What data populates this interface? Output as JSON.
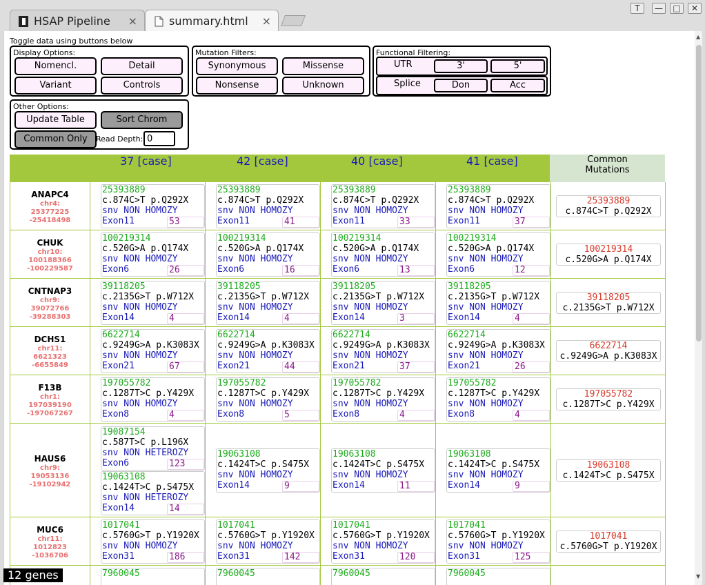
{
  "browser": {
    "tabs": [
      {
        "label": "HSAP Pipeline",
        "close": "×"
      },
      {
        "label": "summary.html",
        "close": "×"
      }
    ],
    "window_buttons": [
      "T",
      "—",
      "□",
      "✕"
    ]
  },
  "toggle_text": "Toggle data using buttons below",
  "display": {
    "title": "Display Options:",
    "nomencl": "Nomencl.",
    "detail": "Detail",
    "variant": "Variant",
    "controls": "Controls"
  },
  "mutation": {
    "title": "Mutation Filters:",
    "synonymous": "Synonymous",
    "missense": "Missense",
    "nonsense": "Nonsense",
    "unknown": "Unknown"
  },
  "functional": {
    "title": "Functional Filtering:",
    "utr": "UTR",
    "utr3": "3'",
    "utr5": "5'",
    "splice": "Splice",
    "don": "Don",
    "acc": "Acc"
  },
  "other": {
    "title": "Other Options:",
    "update": "Update Table",
    "sort": "Sort Chrom",
    "common_only": "Common Only",
    "read_depth_label": "Read Depth:",
    "read_depth_value": "0"
  },
  "header": {
    "cases": [
      "37 [case]",
      "42 [case]",
      "40 [case]",
      "41 [case]"
    ],
    "common": "Common Mutations"
  },
  "genes": [
    {
      "name": "ANAPC4",
      "chr": "chr4:",
      "start": "25377225",
      "end": "-25418498",
      "cards": [
        [
          {
            "pos": "25393889",
            "change": "c.874C>T p.Q292X",
            "type": "snv NON HOMOZY",
            "exon": "Exon11",
            "depth": "53"
          }
        ],
        [
          {
            "pos": "25393889",
            "change": "c.874C>T p.Q292X",
            "type": "snv NON HOMOZY",
            "exon": "Exon11",
            "depth": "41"
          }
        ],
        [
          {
            "pos": "25393889",
            "change": "c.874C>T p.Q292X",
            "type": "snv NON HOMOZY",
            "exon": "Exon11",
            "depth": "33"
          }
        ],
        [
          {
            "pos": "25393889",
            "change": "c.874C>T p.Q292X",
            "type": "snv NON HOMOZY",
            "exon": "Exon11",
            "depth": "37"
          }
        ]
      ],
      "common": {
        "pos": "25393889",
        "change": "c.874C>T p.Q292X"
      }
    },
    {
      "name": "CHUK",
      "chr": "chr10:",
      "start": "100188366",
      "end": "-100229587",
      "cards": [
        [
          {
            "pos": "100219314",
            "change": "c.520G>A p.Q174X",
            "type": "snv NON HOMOZY",
            "exon": "Exon6",
            "depth": "26"
          }
        ],
        [
          {
            "pos": "100219314",
            "change": "c.520G>A p.Q174X",
            "type": "snv NON HOMOZY",
            "exon": "Exon6",
            "depth": "16"
          }
        ],
        [
          {
            "pos": "100219314",
            "change": "c.520G>A p.Q174X",
            "type": "snv NON HOMOZY",
            "exon": "Exon6",
            "depth": "13"
          }
        ],
        [
          {
            "pos": "100219314",
            "change": "c.520G>A p.Q174X",
            "type": "snv NON HOMOZY",
            "exon": "Exon6",
            "depth": "12"
          }
        ]
      ],
      "common": {
        "pos": "100219314",
        "change": "c.520G>A p.Q174X"
      }
    },
    {
      "name": "CNTNAP3",
      "chr": "chr9:",
      "start": "39072766",
      "end": "-39288303",
      "cards": [
        [
          {
            "pos": "39118205",
            "change": "c.2135G>T p.W712X",
            "type": "snv NON HOMOZY",
            "exon": "Exon14",
            "depth": "4"
          }
        ],
        [
          {
            "pos": "39118205",
            "change": "c.2135G>T p.W712X",
            "type": "snv NON HOMOZY",
            "exon": "Exon14",
            "depth": "4"
          }
        ],
        [
          {
            "pos": "39118205",
            "change": "c.2135G>T p.W712X",
            "type": "snv NON HOMOZY",
            "exon": "Exon14",
            "depth": "3"
          }
        ],
        [
          {
            "pos": "39118205",
            "change": "c.2135G>T p.W712X",
            "type": "snv NON HOMOZY",
            "exon": "Exon14",
            "depth": "4"
          }
        ]
      ],
      "common": {
        "pos": "39118205",
        "change": "c.2135G>T p.W712X"
      }
    },
    {
      "name": "DCHS1",
      "chr": "chr11:",
      "start": "6621323",
      "end": "-6655849",
      "cards": [
        [
          {
            "pos": "6622714",
            "change": "c.9249G>A p.K3083X",
            "type": "snv NON HOMOZY",
            "exon": "Exon21",
            "depth": "67"
          }
        ],
        [
          {
            "pos": "6622714",
            "change": "c.9249G>A p.K3083X",
            "type": "snv NON HOMOZY",
            "exon": "Exon21",
            "depth": "44"
          }
        ],
        [
          {
            "pos": "6622714",
            "change": "c.9249G>A p.K3083X",
            "type": "snv NON HOMOZY",
            "exon": "Exon21",
            "depth": "37"
          }
        ],
        [
          {
            "pos": "6622714",
            "change": "c.9249G>A p.K3083X",
            "type": "snv NON HOMOZY",
            "exon": "Exon21",
            "depth": "26"
          }
        ]
      ],
      "common": {
        "pos": "6622714",
        "change": "c.9249G>A p.K3083X"
      }
    },
    {
      "name": "F13B",
      "chr": "chr1:",
      "start": "197039190",
      "end": "-197067267",
      "cards": [
        [
          {
            "pos": "197055782",
            "change": "c.1287T>C p.Y429X",
            "type": "snv NON HOMOZY",
            "exon": "Exon8",
            "depth": "4"
          }
        ],
        [
          {
            "pos": "197055782",
            "change": "c.1287T>C p.Y429X",
            "type": "snv NON HOMOZY",
            "exon": "Exon8",
            "depth": "5"
          }
        ],
        [
          {
            "pos": "197055782",
            "change": "c.1287T>C p.Y429X",
            "type": "snv NON HOMOZY",
            "exon": "Exon8",
            "depth": "4"
          }
        ],
        [
          {
            "pos": "197055782",
            "change": "c.1287T>C p.Y429X",
            "type": "snv NON HOMOZY",
            "exon": "Exon8",
            "depth": "4"
          }
        ]
      ],
      "common": {
        "pos": "197055782",
        "change": "c.1287T>C p.Y429X"
      }
    },
    {
      "name": "HAUS6",
      "chr": "chr9:",
      "start": "19053136",
      "end": "-19102942",
      "cards": [
        [
          {
            "pos": "19087154",
            "change": "c.587T>C p.L196X",
            "type": "snv NON HETEROZY",
            "exon": "Exon6",
            "depth": "123"
          },
          {
            "pos": "19063108",
            "change": "c.1424T>C p.S475X",
            "type": "snv NON HETEROZY",
            "exon": "Exon14",
            "depth": "14"
          }
        ],
        [
          {
            "pos": "19063108",
            "change": "c.1424T>C p.S475X",
            "type": "snv NON HOMOZY",
            "exon": "Exon14",
            "depth": "9"
          }
        ],
        [
          {
            "pos": "19063108",
            "change": "c.1424T>C p.S475X",
            "type": "snv NON HOMOZY",
            "exon": "Exon14",
            "depth": "11"
          }
        ],
        [
          {
            "pos": "19063108",
            "change": "c.1424T>C p.S475X",
            "type": "snv NON HOMOZY",
            "exon": "Exon14",
            "depth": "9"
          }
        ]
      ],
      "common": {
        "pos": "19063108",
        "change": "c.1424T>C p.S475X"
      }
    },
    {
      "name": "MUC6",
      "chr": "chr11:",
      "start": "1012823",
      "end": "-1036706",
      "cards": [
        [
          {
            "pos": "1017041",
            "change": "c.5760G>T p.Y1920X",
            "type": "snv NON HOMOZY",
            "exon": "Exon31",
            "depth": "186"
          }
        ],
        [
          {
            "pos": "1017041",
            "change": "c.5760G>T p.Y1920X",
            "type": "snv NON HOMOZY",
            "exon": "Exon31",
            "depth": "142"
          }
        ],
        [
          {
            "pos": "1017041",
            "change": "c.5760G>T p.Y1920X",
            "type": "snv NON HOMOZY",
            "exon": "Exon31",
            "depth": "120"
          }
        ],
        [
          {
            "pos": "1017041",
            "change": "c.5760G>T p.Y1920X",
            "type": "snv NON HOMOZY",
            "exon": "Exon31",
            "depth": "125"
          }
        ]
      ],
      "common": {
        "pos": "1017041",
        "change": "c.5760G>T p.Y1920X"
      }
    },
    {
      "name": "",
      "chr": "",
      "start": "",
      "end": "",
      "cards": [
        [
          {
            "pos": "7960045",
            "change": "",
            "type": "",
            "exon": "",
            "depth": ""
          }
        ],
        [
          {
            "pos": "7960045",
            "change": "",
            "type": "",
            "exon": "",
            "depth": ""
          }
        ],
        [
          {
            "pos": "7960045",
            "change": "",
            "type": "",
            "exon": "",
            "depth": ""
          }
        ],
        [
          {
            "pos": "7960045",
            "change": "",
            "type": "",
            "exon": "",
            "depth": ""
          }
        ]
      ],
      "common": null
    }
  ],
  "gene_count": "12 genes"
}
